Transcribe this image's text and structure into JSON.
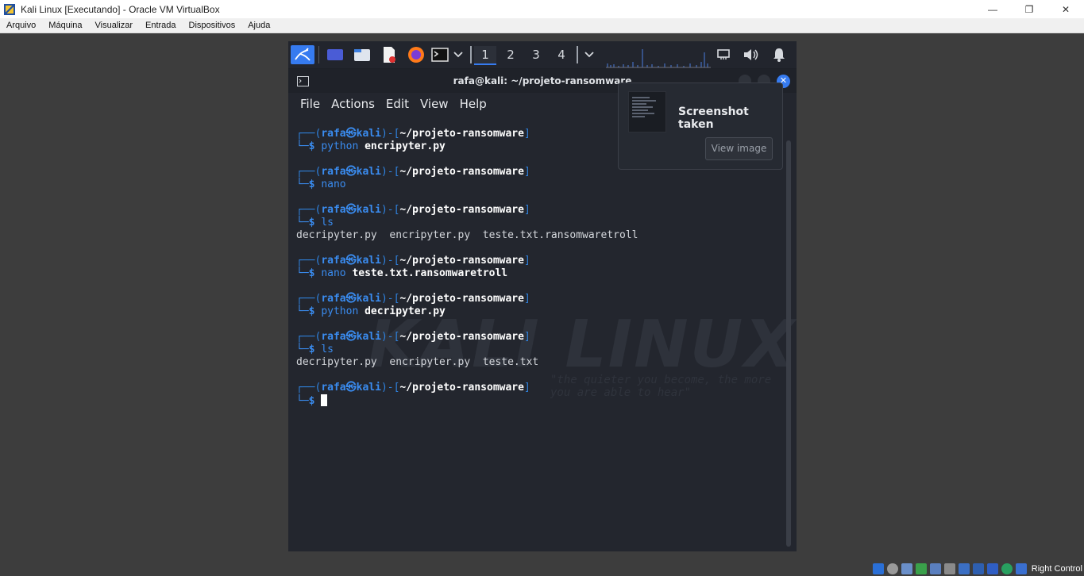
{
  "window": {
    "title": "Kali Linux [Executando] - Oracle VM VirtualBox",
    "minimize": "—",
    "restore": "❐",
    "close": "✕"
  },
  "host_menu": [
    "Arquivo",
    "Máquina",
    "Visualizar",
    "Entrada",
    "Dispositivos",
    "Ajuda"
  ],
  "panel": {
    "workspaces": [
      "1",
      "2",
      "3",
      "4"
    ],
    "active_workspace": "1"
  },
  "terminal": {
    "title": "rafa@kali: ~/projeto-ransomware",
    "menu": [
      "File",
      "Actions",
      "Edit",
      "View",
      "Help"
    ],
    "prompt": {
      "frame_open": "┌──(",
      "user": "rafa㉿kali",
      "frame_mid": ")-[",
      "dir": "~/projeto-ransomware",
      "frame_close": "]",
      "second": "└─$ "
    },
    "blocks": [
      {
        "cmd": "python",
        "arg": "encripyter.py",
        "output": null
      },
      {
        "cmd": "nano",
        "arg": "",
        "output": null
      },
      {
        "cmd": "ls",
        "arg": "",
        "output": "decripyter.py  encripyter.py  teste.txt.ransomwaretroll"
      },
      {
        "cmd": "nano",
        "arg": "teste.txt.ransomwaretroll",
        "output": null
      },
      {
        "cmd": "python",
        "arg": "decripyter.py",
        "output": null
      },
      {
        "cmd": "ls",
        "arg": "",
        "output": "decripyter.py  encripyter.py  teste.txt"
      }
    ],
    "watermark": "KALI LINUX",
    "watermark_quote": "\"the quieter you become, the more you are able to hear\""
  },
  "notification": {
    "title": "Screenshot taken",
    "button": "View image"
  },
  "tray": {
    "host_key": "Right Control"
  }
}
